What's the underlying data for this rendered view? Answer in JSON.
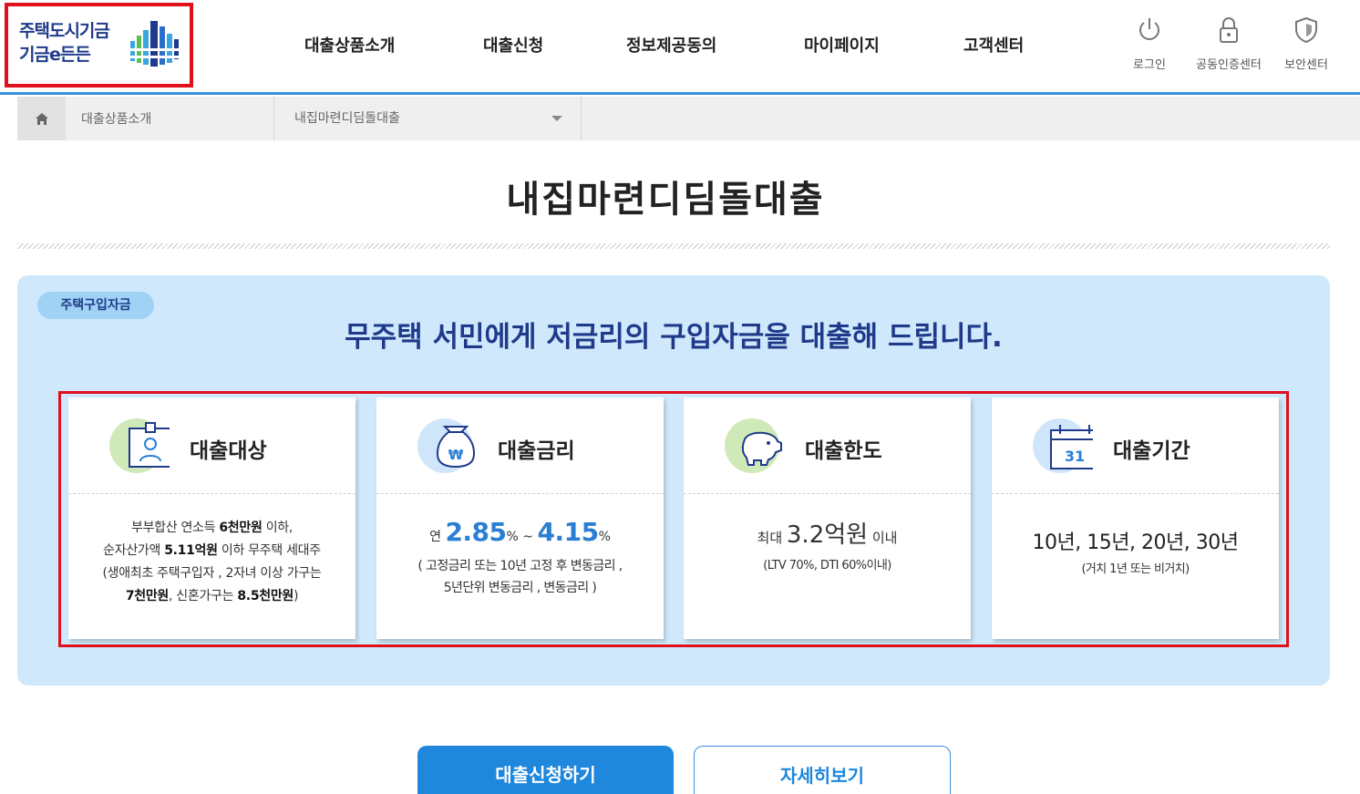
{
  "header": {
    "logo_line1": "주택도시기금",
    "logo_line2": "기금e든든",
    "nav": [
      "대출상품소개",
      "대출신청",
      "정보제공동의",
      "마이페이지",
      "고객센터"
    ],
    "utilities": [
      {
        "label": "로그인",
        "icon": "power-icon"
      },
      {
        "label": "공동인증센터",
        "icon": "lock-icon"
      },
      {
        "label": "보안센터",
        "icon": "shield-icon"
      }
    ]
  },
  "breadcrumb": {
    "home_icon": "home-icon",
    "level1": "대출상품소개",
    "level2": "내집마련디딤돌대출"
  },
  "page": {
    "title": "내집마련디딤돌대출"
  },
  "summary": {
    "badge": "주택구입자금",
    "headline": "무주택 서민에게 저금리의 구입자금을 대출해 드립니다."
  },
  "cards": {
    "target": {
      "title": "대출대상",
      "icon": "id-badge-icon",
      "l1a": "부부합산 연소득 ",
      "l1b": "6천만원",
      "l1c": " 이하,",
      "l2a": "순자산가액 ",
      "l2b": "5.11억원",
      "l2c": " 이하 무주택 세대주",
      "l3": "(생애최초 주택구입자 , 2자녀 이상 가구는",
      "l4a": "7천만원",
      "l4b": ", 신혼가구는 ",
      "l4c": "8.5천만원",
      "l4d": ")"
    },
    "rate": {
      "title": "대출금리",
      "icon": "money-bag-icon",
      "prefix": "연 ",
      "min": "2.85",
      "unit": "%",
      "tilde": " ~ ",
      "max": "4.15",
      "note1": "( 고정금리 또는 10년 고정 후 변동금리 ,",
      "note2": "5년단위 변동금리 , 변동금리 )"
    },
    "limit": {
      "title": "대출한도",
      "icon": "piggy-bank-icon",
      "prefix": "최대 ",
      "value": "3.2억원",
      "suffix": " 이내",
      "note": "(LTV 70%, DTI 60%이내)"
    },
    "period": {
      "title": "대출기간",
      "icon": "calendar-icon",
      "calendar_day": "31",
      "value": "10년, 15년, 20년, 30년",
      "note": "(거치 1년 또는 비거치)"
    }
  },
  "buttons": {
    "apply": "대출신청하기",
    "details": "자세히보기"
  },
  "colors": {
    "accent": "#1f87dc",
    "navy": "#1f3a8a",
    "panel_bg": "#cfe8fb",
    "highlight_frame": "#e0101c"
  }
}
